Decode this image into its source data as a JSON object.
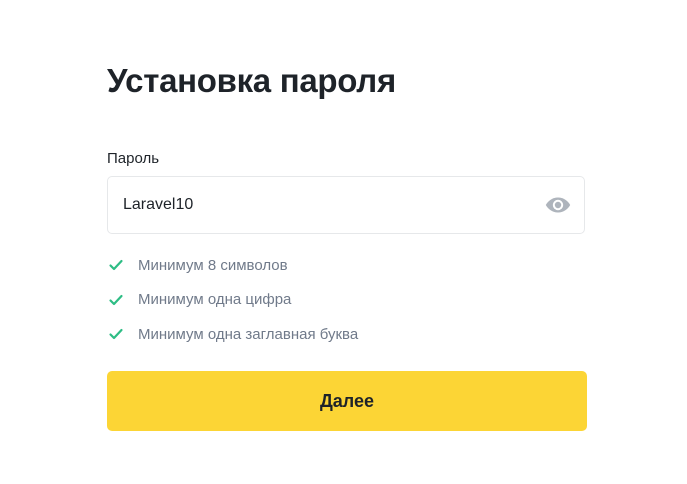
{
  "page": {
    "title": "Установка пароля"
  },
  "password": {
    "label": "Пароль",
    "value": "Laravel10",
    "visibility_icon": "eye-icon"
  },
  "requirements": [
    {
      "text": "Минимум 8 символов",
      "met": true,
      "icon": "check-icon"
    },
    {
      "text": "Минимум одна цифра",
      "met": true,
      "icon": "check-icon"
    },
    {
      "text": "Минимум одна заглавная буква",
      "met": true,
      "icon": "check-icon"
    }
  ],
  "actions": {
    "next_label": "Далее"
  },
  "colors": {
    "accent": "#fcd535",
    "check": "#2ebd85",
    "text_primary": "#1e2329",
    "text_secondary": "#707a8a",
    "border": "#e6e8ea",
    "icon": "#aeb4bc"
  }
}
